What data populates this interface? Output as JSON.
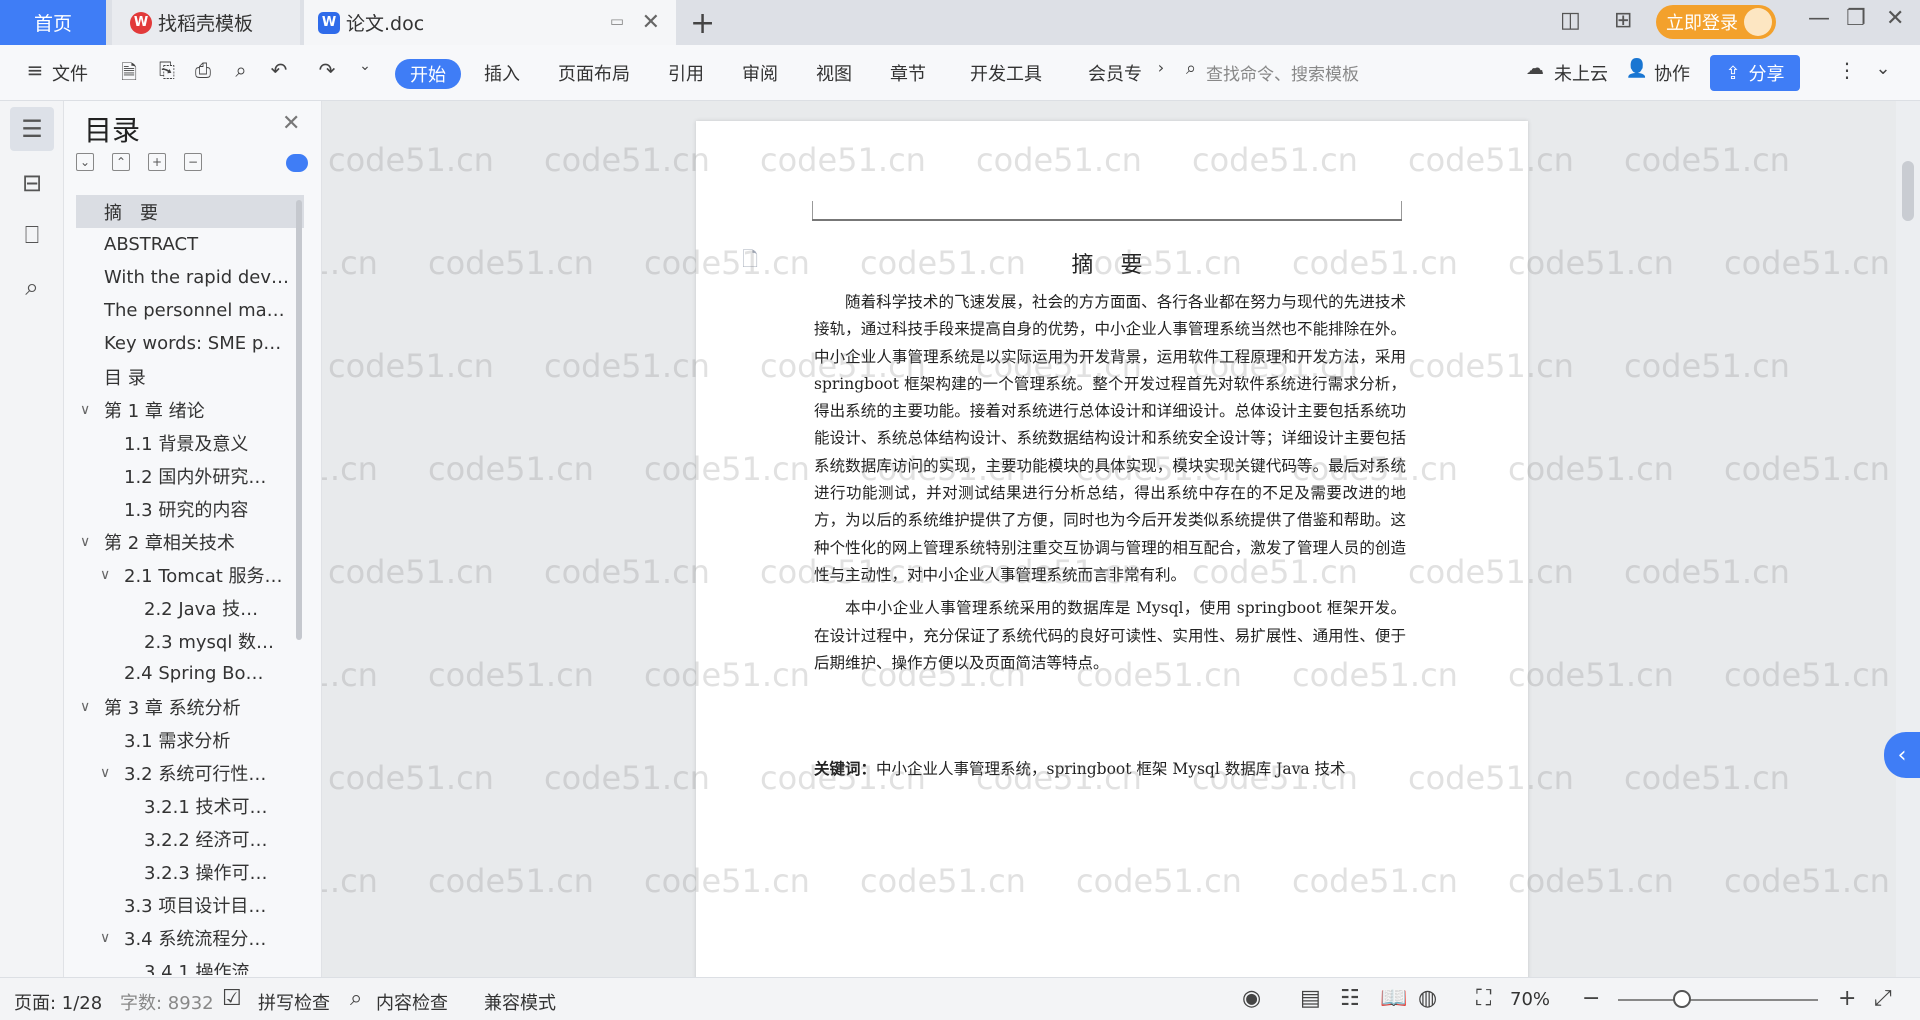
{
  "titlebar": {
    "home_tab": "首页",
    "template_tab": "找稻壳模板",
    "doc_tab": "论文.doc",
    "login_label": "立即登录"
  },
  "ribbon": {
    "file_label": "文件",
    "tabs": [
      "开始",
      "插入",
      "页面布局",
      "引用",
      "审阅",
      "视图",
      "章节",
      "开发工具",
      "会员专"
    ],
    "search_placeholder": "查找命令、搜索模板",
    "cloud_label": "未上云",
    "collab_label": "协作",
    "share_label": "分享"
  },
  "toc": {
    "title": "目录",
    "items": [
      {
        "label": "摘　要",
        "level": 0,
        "chev": "",
        "active": true
      },
      {
        "label": "ABSTRACT",
        "level": 0,
        "chev": ""
      },
      {
        "label": "With the rapid dev…",
        "level": 0,
        "chev": ""
      },
      {
        "label": "The personnel ma…",
        "level": 0,
        "chev": ""
      },
      {
        "label": "Key words: SME p…",
        "level": 0,
        "chev": ""
      },
      {
        "label": "目 录",
        "level": 0,
        "chev": ""
      },
      {
        "label": "第 1 章  绪论",
        "level": 0,
        "chev": "∨"
      },
      {
        "label": "1.1 背景及意义",
        "level": 1,
        "chev": ""
      },
      {
        "label": "1.2  国内外研究…",
        "level": 1,
        "chev": ""
      },
      {
        "label": "1.3  研究的内容",
        "level": 1,
        "chev": ""
      },
      {
        "label": "第 2 章相关技术",
        "level": 0,
        "chev": "∨"
      },
      {
        "label": "2.1 Tomcat 服务…",
        "level": 1,
        "chev": "∨"
      },
      {
        "label": "2.2    Java 技…",
        "level": 2,
        "chev": ""
      },
      {
        "label": "2.3 mysql 数…",
        "level": 2,
        "chev": ""
      },
      {
        "label": "2.4 Spring    Bo…",
        "level": 1,
        "chev": ""
      },
      {
        "label": "第 3 章  系统分析",
        "level": 0,
        "chev": "∨"
      },
      {
        "label": "3.1  需求分析",
        "level": 1,
        "chev": ""
      },
      {
        "label": "3.2  系统可行性…",
        "level": 1,
        "chev": "∨"
      },
      {
        "label": "3.2.1 技术可…",
        "level": 2,
        "chev": ""
      },
      {
        "label": "3.2.2 经济可…",
        "level": 2,
        "chev": ""
      },
      {
        "label": "3.2.3 操作可…",
        "level": 2,
        "chev": ""
      },
      {
        "label": "3.3  项目设计目…",
        "level": 1,
        "chev": ""
      },
      {
        "label": "3.4 系统流程分…",
        "level": 1,
        "chev": "∨"
      },
      {
        "label": "3.4.1 操作流…",
        "level": 2,
        "chev": ""
      }
    ]
  },
  "document": {
    "title": "摘  要",
    "paragraphs": [
      "随着科学技术的飞速发展，社会的方方面面、各行各业都在努力与现代的先进技术接轨，通过科技手段来提高自身的优势，中小企业人事管理系统当然也不能排除在外。中小企业人事管理系统是以实际运用为开发背景，运用软件工程原理和开发方法，采用 springboot 框架构建的一个管理系统。整个开发过程首先对软件系统进行需求分析，得出系统的主要功能。接着对系统进行总体设计和详细设计。总体设计主要包括系统功能设计、系统总体结构设计、系统数据结构设计和系统安全设计等；详细设计主要包括系统数据库访问的实现，主要功能模块的具体实现，模块实现关键代码等。最后对系统进行功能测试，并对测试结果进行分析总结，得出系统中存在的不足及需要改进的地方，为以后的系统维护提供了方便，同时也为今后开发类似系统提供了借鉴和帮助。这种个性化的网上管理系统特别注重交互协调与管理的相互配合，激发了管理人员的创造性与主动性，对中小企业人事管理系统而言非常有利。",
      "本中小企业人事管理系统采用的数据库是 Mysql，使用 springboot 框架开发。在设计过程中，充分保证了系统代码的良好可读性、实用性、易扩展性、通用性、便于后期维护、操作方便以及页面简洁等特点。"
    ],
    "keywords_label": "关键词：",
    "keywords": "中小企业人事管理系统，springboot 框架 Mysql 数据库 Java 技术",
    "watermark": "code51.cn"
  },
  "statusbar": {
    "page": "页面: 1/28",
    "words": "字数: 8932",
    "spell": "拼写检查",
    "content_check": "内容检查",
    "compat": "兼容模式",
    "zoom": "70%"
  },
  "colors": {
    "accent": "#3f7df6",
    "login": "#f3a12c"
  }
}
